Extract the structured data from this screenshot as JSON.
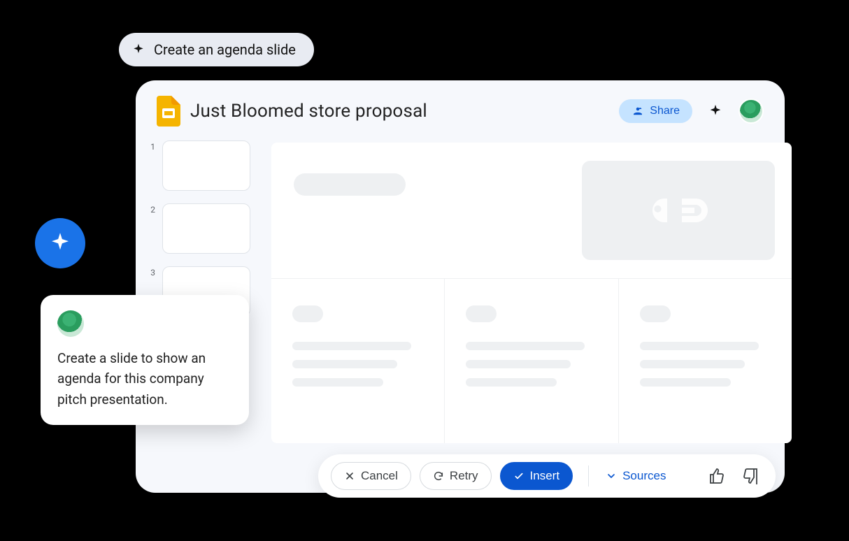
{
  "chip": {
    "label": "Create an agenda slide"
  },
  "doc": {
    "title": "Just Bloomed store proposal"
  },
  "header": {
    "share_label": "Share"
  },
  "thumbs": {
    "numbers": [
      "1",
      "2",
      "3"
    ]
  },
  "prompt": {
    "text": "Create a slide to show an agenda for this company pitch presentation."
  },
  "toolbar": {
    "cancel_label": "Cancel",
    "retry_label": "Retry",
    "insert_label": "Insert",
    "sources_label": "Sources"
  },
  "colors": {
    "primary": "#0b57d0",
    "accent": "#1a73e8",
    "share_bg": "#c5e3ff"
  }
}
